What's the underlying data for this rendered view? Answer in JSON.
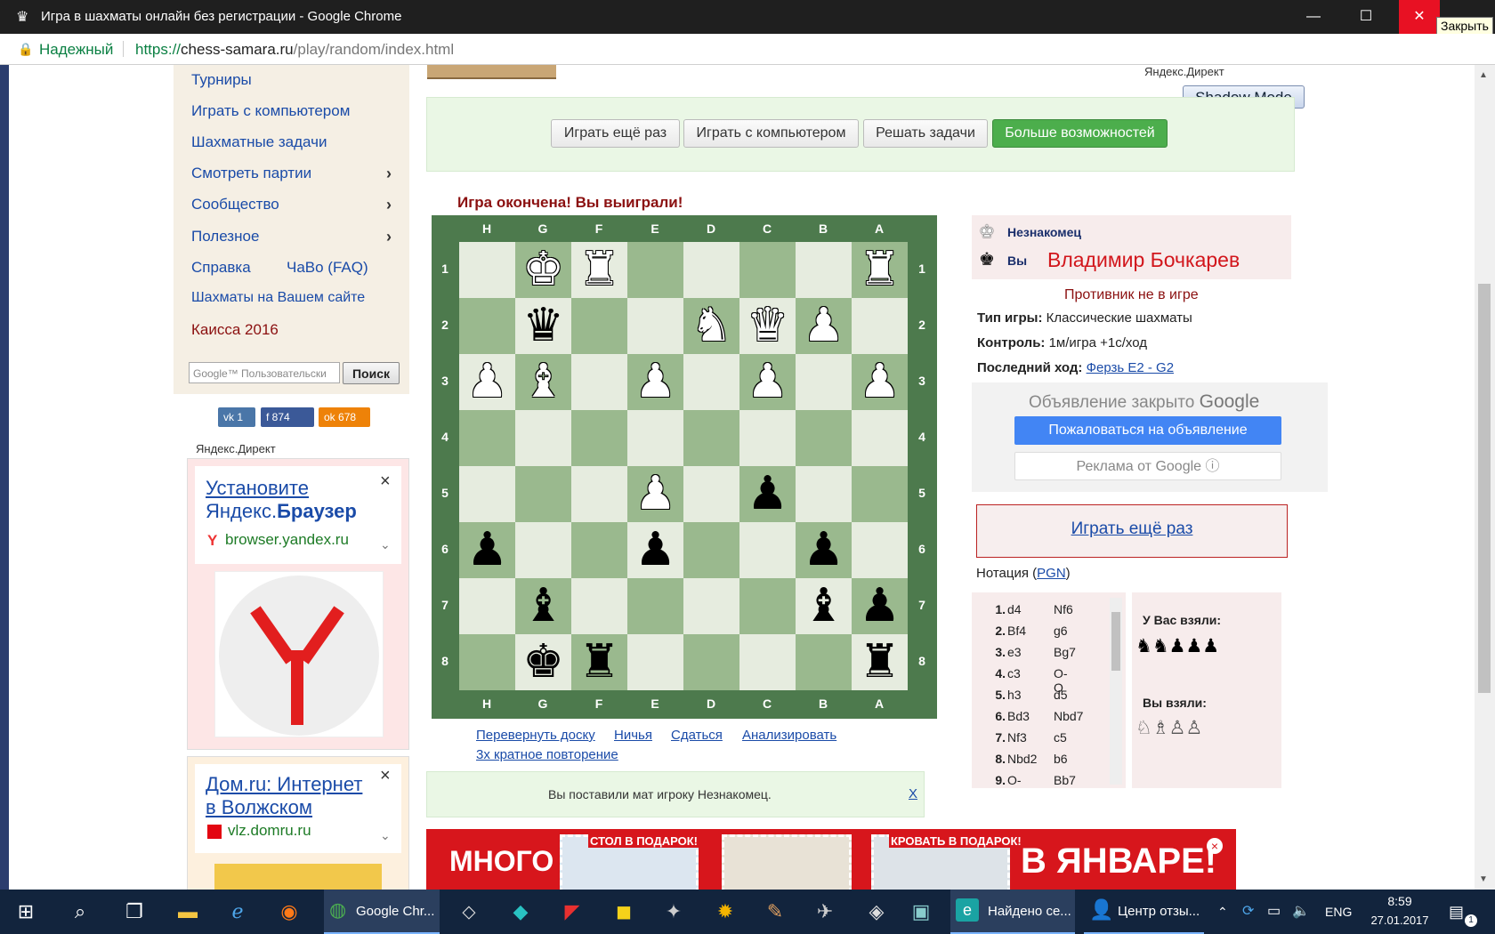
{
  "window": {
    "title": "Игра в шахматы онлайн без регистрации - Google Chrome",
    "tooltip": "Закрыть",
    "minimize": "—",
    "maximize": "☐",
    "close": "✕"
  },
  "address": {
    "secure_label": "Надежный",
    "url_proto": "https://",
    "url_host": "chess-samara.ru",
    "url_path": "/play/random/index.html"
  },
  "menu": {
    "items": [
      {
        "label": "Турниры",
        "arrow": false
      },
      {
        "label": "Играть с компьютером",
        "arrow": false
      },
      {
        "label": "Шахматные задачи",
        "arrow": false
      },
      {
        "label": "Смотреть партии",
        "arrow": true
      },
      {
        "label": "Сообщество",
        "arrow": true
      },
      {
        "label": "Полезное",
        "arrow": true
      }
    ],
    "help": "Справка",
    "faq": "ЧаВо (FAQ)",
    "site": "Шахматы на Вашем сайте",
    "kaissa": "Каисса 2016",
    "search_placeholder": "Google™ Пользовательски",
    "search_button": "Поиск"
  },
  "social": {
    "vk": "1",
    "fb": "874",
    "ok": "678"
  },
  "yandex_direct_label": "Яндекс.Директ",
  "ads": {
    "yandex": {
      "title_1": "Установите",
      "title_2": "Яндекс.",
      "title_bold": "Браузер",
      "url": "browser.yandex.ru"
    },
    "domru": {
      "title_1": "Дом.ru: Интернет",
      "title_2": "в Волжском",
      "url": "vlz.domru.ru"
    }
  },
  "top_buttons": {
    "play_again": "Играть ещё раз",
    "play_computer": "Играть с компьютером",
    "solve": "Решать задачи",
    "more": "Больше возможностей"
  },
  "shadow_mode": "Shadow Mode",
  "game": {
    "status": "Игра окончена! Вы выиграли!",
    "files": [
      "H",
      "G",
      "F",
      "E",
      "D",
      "C",
      "B",
      "A"
    ],
    "ranks": [
      "1",
      "2",
      "3",
      "4",
      "5",
      "6",
      "7",
      "8"
    ],
    "board": [
      [
        "",
        "wK",
        "wR",
        "",
        "",
        "",
        "",
        "wR"
      ],
      [
        "",
        "bQ",
        "",
        "",
        "wN",
        "wQ",
        "wP",
        ""
      ],
      [
        "wP",
        "wB",
        "",
        "wP",
        "",
        "wP",
        "",
        "wP"
      ],
      [
        "",
        "",
        "",
        "",
        "",
        "",
        "",
        ""
      ],
      [
        "",
        "",
        "",
        "wP",
        "",
        "bP",
        "",
        ""
      ],
      [
        "bP",
        "",
        "",
        "bP",
        "",
        "",
        "bP",
        ""
      ],
      [
        "",
        "bB",
        "",
        "",
        "",
        "",
        "bB",
        "bP"
      ],
      [
        "",
        "bK",
        "bR",
        "",
        "",
        "",
        "",
        "bR"
      ]
    ],
    "links": {
      "flip": "Перевернуть доску",
      "draw": "Ничья",
      "resign": "Сдаться",
      "analyze": "Анализировать",
      "repetition": "3х кратное повторение"
    },
    "mate_message": "Вы поставили мат игроку Незнакомец.",
    "mate_close": "X"
  },
  "players": {
    "opponent": "Незнакомец",
    "you_label": "Вы",
    "you_name": "Владимир Бочкарев",
    "opponent_status": "Противник не в игре"
  },
  "info": {
    "type_label": "Тип игры:",
    "type_value": "Классические шахматы",
    "control_label": "Контроль:",
    "control_value": "1м/игра +1с/ход",
    "last_label": "Последний ход:",
    "last_value": "Ферзь E2 - G2"
  },
  "google_ad": {
    "closed": "Объявление закрыто",
    "google": "Google",
    "report": "Пожаловаться на объявление",
    "by_google": "Реклама от Google ⓘ"
  },
  "play_again_link": "Играть ещё раз",
  "notation": {
    "label": "Нотация (",
    "pgn": "PGN",
    "label_end": ")",
    "moves": [
      [
        "1.",
        "d4",
        "Nf6"
      ],
      [
        "2.",
        "Bf4",
        "g6"
      ],
      [
        "3.",
        "e3",
        "Bg7"
      ],
      [
        "4.",
        "c3",
        "O-O"
      ],
      [
        "5.",
        "h3",
        "d5"
      ],
      [
        "6.",
        "Bd3",
        "Nbd7"
      ],
      [
        "7.",
        "Nf3",
        "c5"
      ],
      [
        "8.",
        "Nbd2",
        "b6"
      ],
      [
        "9.",
        "O-O",
        "Bb7"
      ]
    ]
  },
  "captured": {
    "taken_from_you": "У Вас взяли:",
    "you_took": "Вы взяли:",
    "taken_from_you_pieces": "♞♞♟♟♟",
    "you_took_pieces": "♘♗♙♙"
  },
  "banner": {
    "left_text": "МНОГО",
    "stamp_1": "СТОЛ В ПОДАРОК!",
    "stamp_2": "КРОВАТЬ В ПОДАРОК!",
    "right_text": "В ЯНВАРЕ!"
  },
  "taskbar": {
    "chrome": "Google Chr...",
    "found": "Найдено се...",
    "feedback": "Центр отзы...",
    "lang": "ENG",
    "time": "8:59",
    "date": "27.01.2017",
    "notif_count": "1"
  }
}
